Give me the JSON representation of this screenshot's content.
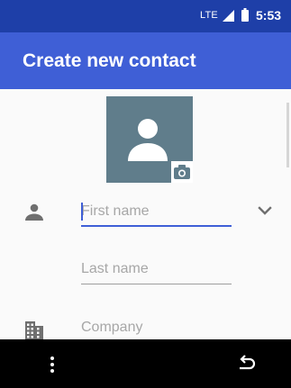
{
  "status_bar": {
    "network": "LTE",
    "time": "5:53",
    "signal_icon": "signal-icon",
    "battery_icon": "battery-icon"
  },
  "app_bar": {
    "title": "Create new contact"
  },
  "photo": {
    "icon": "person-icon",
    "camera_icon": "camera-icon",
    "background_color": "#607d8b"
  },
  "form": {
    "first_name": {
      "placeholder": "First name",
      "value": ""
    },
    "last_name": {
      "placeholder": "Last name",
      "value": ""
    },
    "company": {
      "placeholder": "Company",
      "value": ""
    },
    "icons": {
      "name": "person-outline-icon",
      "company": "building-icon",
      "expand": "chevron-down-icon"
    }
  },
  "nav_bar": {
    "menu_icon": "more-vert-icon",
    "back_icon": "back-icon"
  },
  "colors": {
    "status_bar": "#1e3fa8",
    "app_bar": "#3f5fd6",
    "accent": "#3f5fd6",
    "nav_bar": "#000000"
  }
}
